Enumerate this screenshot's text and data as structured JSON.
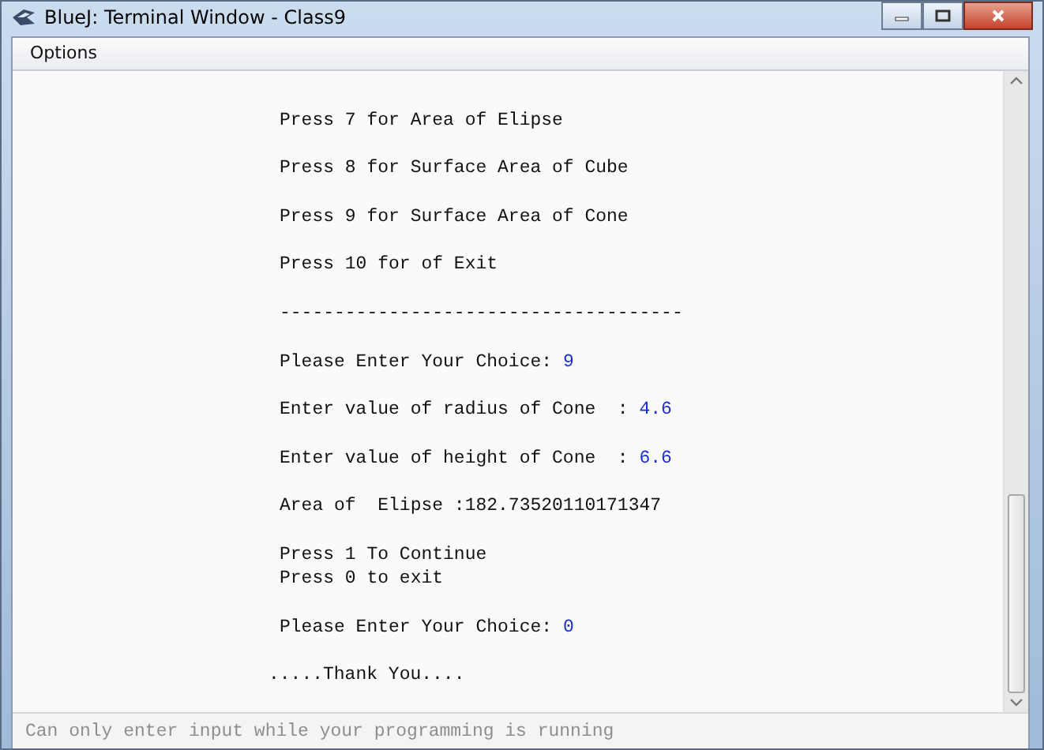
{
  "window": {
    "title": "BlueJ: Terminal Window - Class9"
  },
  "menu": [
    {
      "label": "Options"
    }
  ],
  "terminal": {
    "blocks": [
      {
        "kind": "output",
        "lines": [
          {
            "text": "Press 7 for Area of Elipse"
          }
        ]
      },
      {
        "kind": "output",
        "lines": [
          {
            "text": "Press 8 for Surface Area of Cube"
          }
        ]
      },
      {
        "kind": "output",
        "lines": [
          {
            "text": "Press 9 for Surface Area of Cone"
          }
        ]
      },
      {
        "kind": "output",
        "lines": [
          {
            "text": "Press 10 for of Exit"
          }
        ]
      },
      {
        "kind": "output",
        "lines": [
          {
            "text": "-------------------------------------"
          }
        ]
      },
      {
        "kind": "output",
        "lines": [
          {
            "text": "Please Enter Your Choice: ",
            "input": "9"
          }
        ]
      },
      {
        "kind": "output",
        "lines": [
          {
            "text": "Enter value of radius of Cone  : ",
            "input": "4.6"
          }
        ]
      },
      {
        "kind": "output",
        "lines": [
          {
            "text": "Enter value of height of Cone  : ",
            "input": "6.6"
          }
        ]
      },
      {
        "kind": "output",
        "lines": [
          {
            "text": "Area of  Elipse :182.73520110171347"
          }
        ]
      },
      {
        "kind": "output",
        "lines": [
          {
            "text": "Press 1 To Continue"
          },
          {
            "text": "Press 0 to exit"
          }
        ]
      },
      {
        "kind": "output",
        "lines": [
          {
            "text": "Please Enter Your Choice: ",
            "input": "0"
          }
        ]
      },
      {
        "kind": "outdent",
        "lines": [
          {
            "text": ".....Thank You...."
          }
        ]
      }
    ]
  },
  "input_field": {
    "placeholder": "Can only enter input while your programming is running"
  }
}
